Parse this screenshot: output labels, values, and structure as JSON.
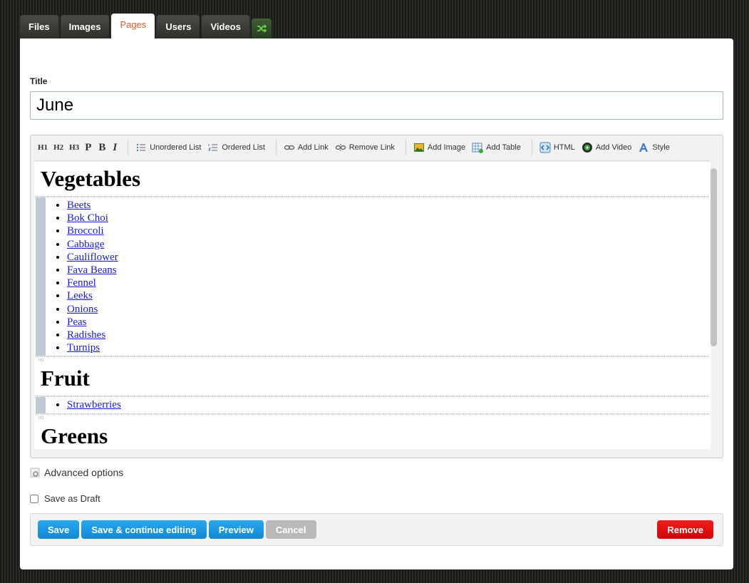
{
  "tabs": [
    {
      "label": "Files"
    },
    {
      "label": "Images"
    },
    {
      "label": "Pages"
    },
    {
      "label": "Users"
    },
    {
      "label": "Videos"
    }
  ],
  "active_tab": "Pages",
  "shuffle_icon": "shuffle-icon",
  "form": {
    "title_label": "Title",
    "title_value": "June"
  },
  "toolbar": {
    "h1": "H1",
    "h2": "H2",
    "h3": "H3",
    "p": "P",
    "b": "B",
    "i": "I",
    "unordered_list": "Unordered List",
    "ordered_list": "Ordered List",
    "add_link": "Add Link",
    "remove_link": "Remove Link",
    "add_image": "Add Image",
    "add_table": "Add Table",
    "html": "HTML",
    "add_video": "Add Video",
    "style": "Style"
  },
  "content": {
    "block_tag": "H1",
    "heading1": "Vegetables",
    "vegetables": [
      "Beets",
      "Bok Choi",
      "Broccoli",
      "Cabbage",
      "Cauliflower",
      "Fava Beans",
      "Fennel",
      "Leeks",
      "Onions",
      "Peas",
      "Radishes",
      "Turnips"
    ],
    "heading2": "Fruit",
    "fruit": [
      "Strawberries"
    ],
    "heading3": "Greens"
  },
  "advanced_options": "Advanced options",
  "save_as_draft": "Save as Draft",
  "buttons": {
    "save": "Save",
    "save_continue": "Save & continue editing",
    "preview": "Preview",
    "cancel": "Cancel",
    "remove": "Remove"
  },
  "colors": {
    "active_tab_text": "#e05a24",
    "primary": "#1b99e0",
    "danger": "#e01010",
    "disabled": "#b9b9b9"
  }
}
